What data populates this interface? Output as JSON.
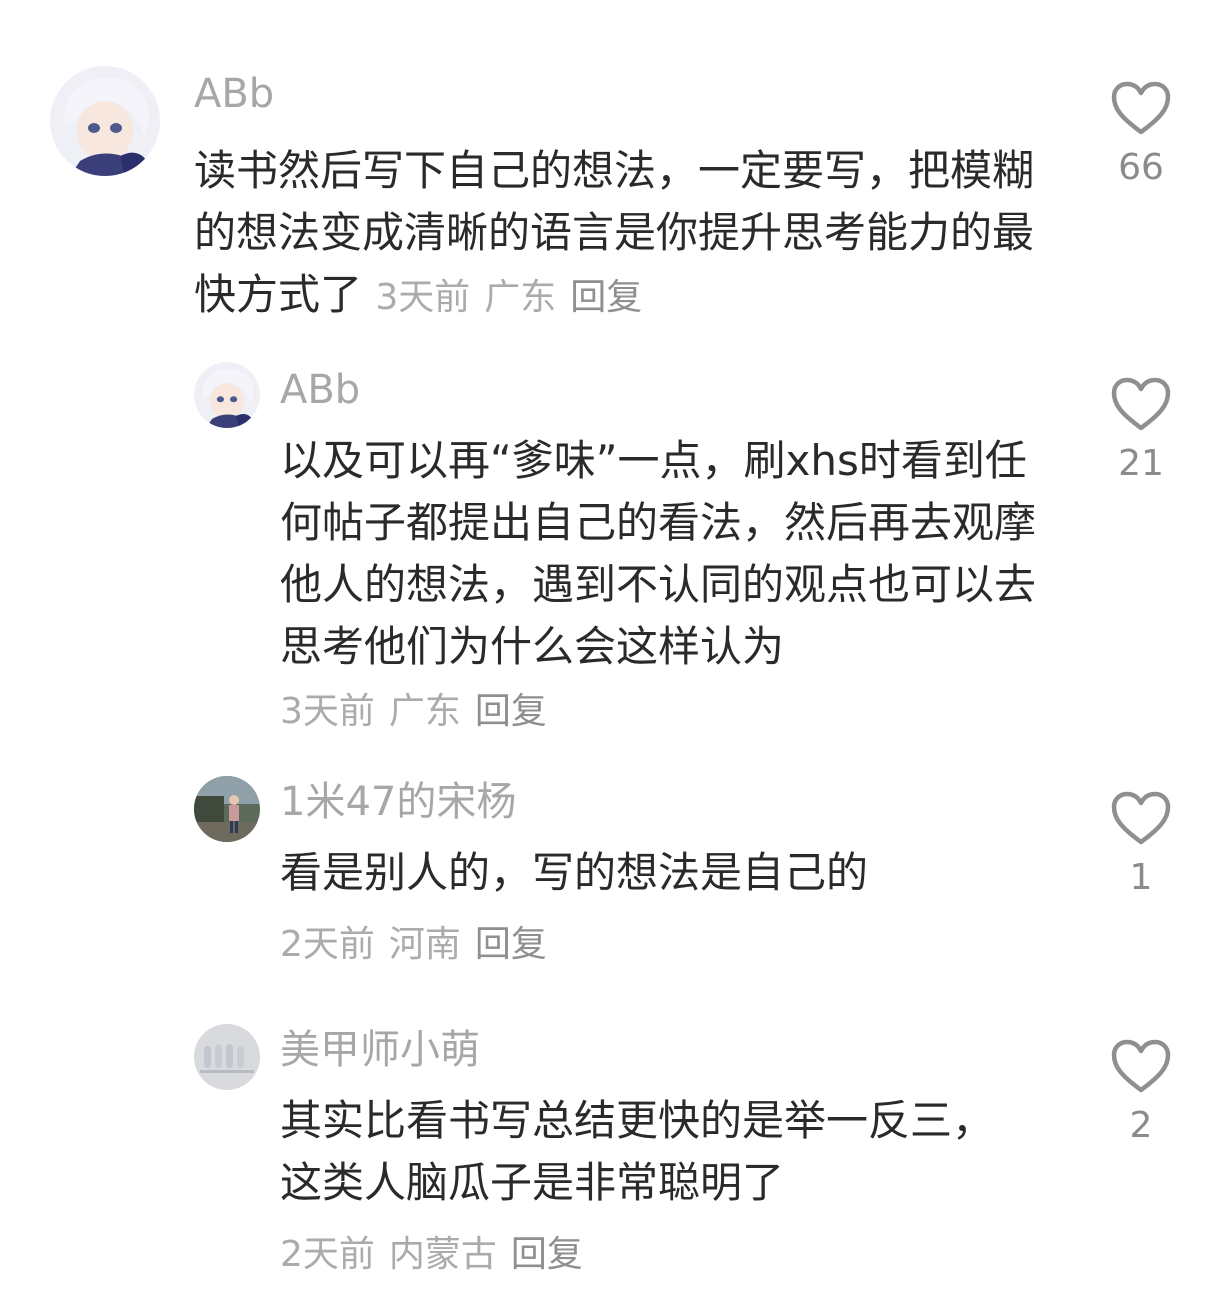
{
  "comments": [
    {
      "username": "ABb",
      "text": "读书然后写下自己的想法，一定要写，把模糊的想法变成清晰的语言是你提升思考能力的最快方式了",
      "time": "3天前",
      "location": "广东",
      "reply_label": "回复",
      "likes": "66",
      "avatar": "anime-boy-avatar",
      "is_reply": false
    },
    {
      "username": "ABb",
      "text": "以及可以再“爹味”一点，刷xhs时看到任何帖子都提出自己的看法，然后再去观摩他人的想法，遇到不认同的观点也可以去思考他们为什么会这样认为",
      "time": "3天前",
      "location": "广东",
      "reply_label": "回复",
      "likes": "21",
      "avatar": "anime-boy-avatar",
      "is_reply": true
    },
    {
      "username": "1米47的宋杨",
      "text": "看是别人的，写的想法是自己的",
      "time": "2天前",
      "location": "河南",
      "reply_label": "回复",
      "likes": "1",
      "avatar": "person-outdoor-avatar",
      "is_reply": true
    },
    {
      "username": "美甲师小萌",
      "text": "其实比看书写总结更快的是举一反三，这类人脑瓜子是非常聪明了",
      "time": "2天前",
      "location": "内蒙古",
      "reply_label": "回复",
      "likes": "2",
      "avatar": "nails-avatar",
      "is_reply": true
    }
  ],
  "colors": {
    "text": "#2a2a2a",
    "muted": "#a7a7a7",
    "icon": "#8f8f8f",
    "background": "#ffffff"
  }
}
